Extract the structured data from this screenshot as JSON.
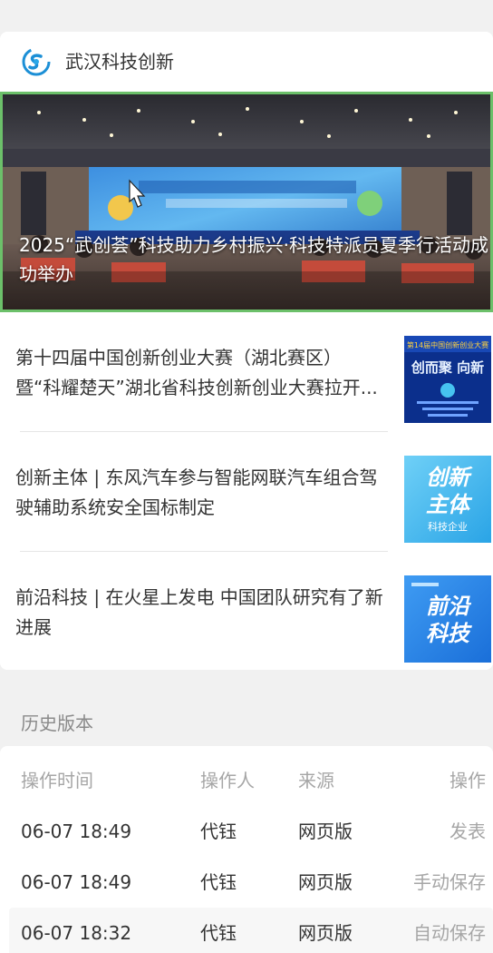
{
  "account": {
    "name": "武汉科技创新",
    "logo_icon": "wuhan-tech-logo",
    "brand_color": "#1c8fd6"
  },
  "hero": {
    "title": "2025“武创荟”科技助力乡村振兴·科技特派员夏季行活动成功举办",
    "image_icon": "conference-stage-photo",
    "border_color": "#6cc06a"
  },
  "articles": [
    {
      "title": "第十四届中国创新创业大赛（湖北赛区）暨“科耀楚天”湖北省科技创新创业大赛拉开...",
      "thumb_icon": "competition-banner-thumbnail"
    },
    {
      "title": "创新主体 | 东风汽车参与智能网联汽车组合驾驶辅助系统安全国标制定",
      "thumb_icon": "innovation-subject-thumbnail",
      "thumb_text": [
        "创新",
        "主体",
        "科技企业"
      ]
    },
    {
      "title": "前沿科技 | 在火星上发电 中国团队研究有了新进展",
      "thumb_icon": "frontier-tech-thumbnail",
      "thumb_text": [
        "前沿",
        "科技"
      ]
    }
  ],
  "history": {
    "label": "历史版本",
    "columns": [
      "操作时间",
      "操作人",
      "来源",
      "操作"
    ],
    "rows": [
      {
        "time": "06-07 18:49",
        "operator": "代钰",
        "source": "网页版",
        "action": "发表"
      },
      {
        "time": "06-07 18:49",
        "operator": "代钰",
        "source": "网页版",
        "action": "手动保存"
      },
      {
        "time": "06-07 18:32",
        "operator": "代钰",
        "source": "网页版",
        "action": "自动保存"
      }
    ]
  }
}
